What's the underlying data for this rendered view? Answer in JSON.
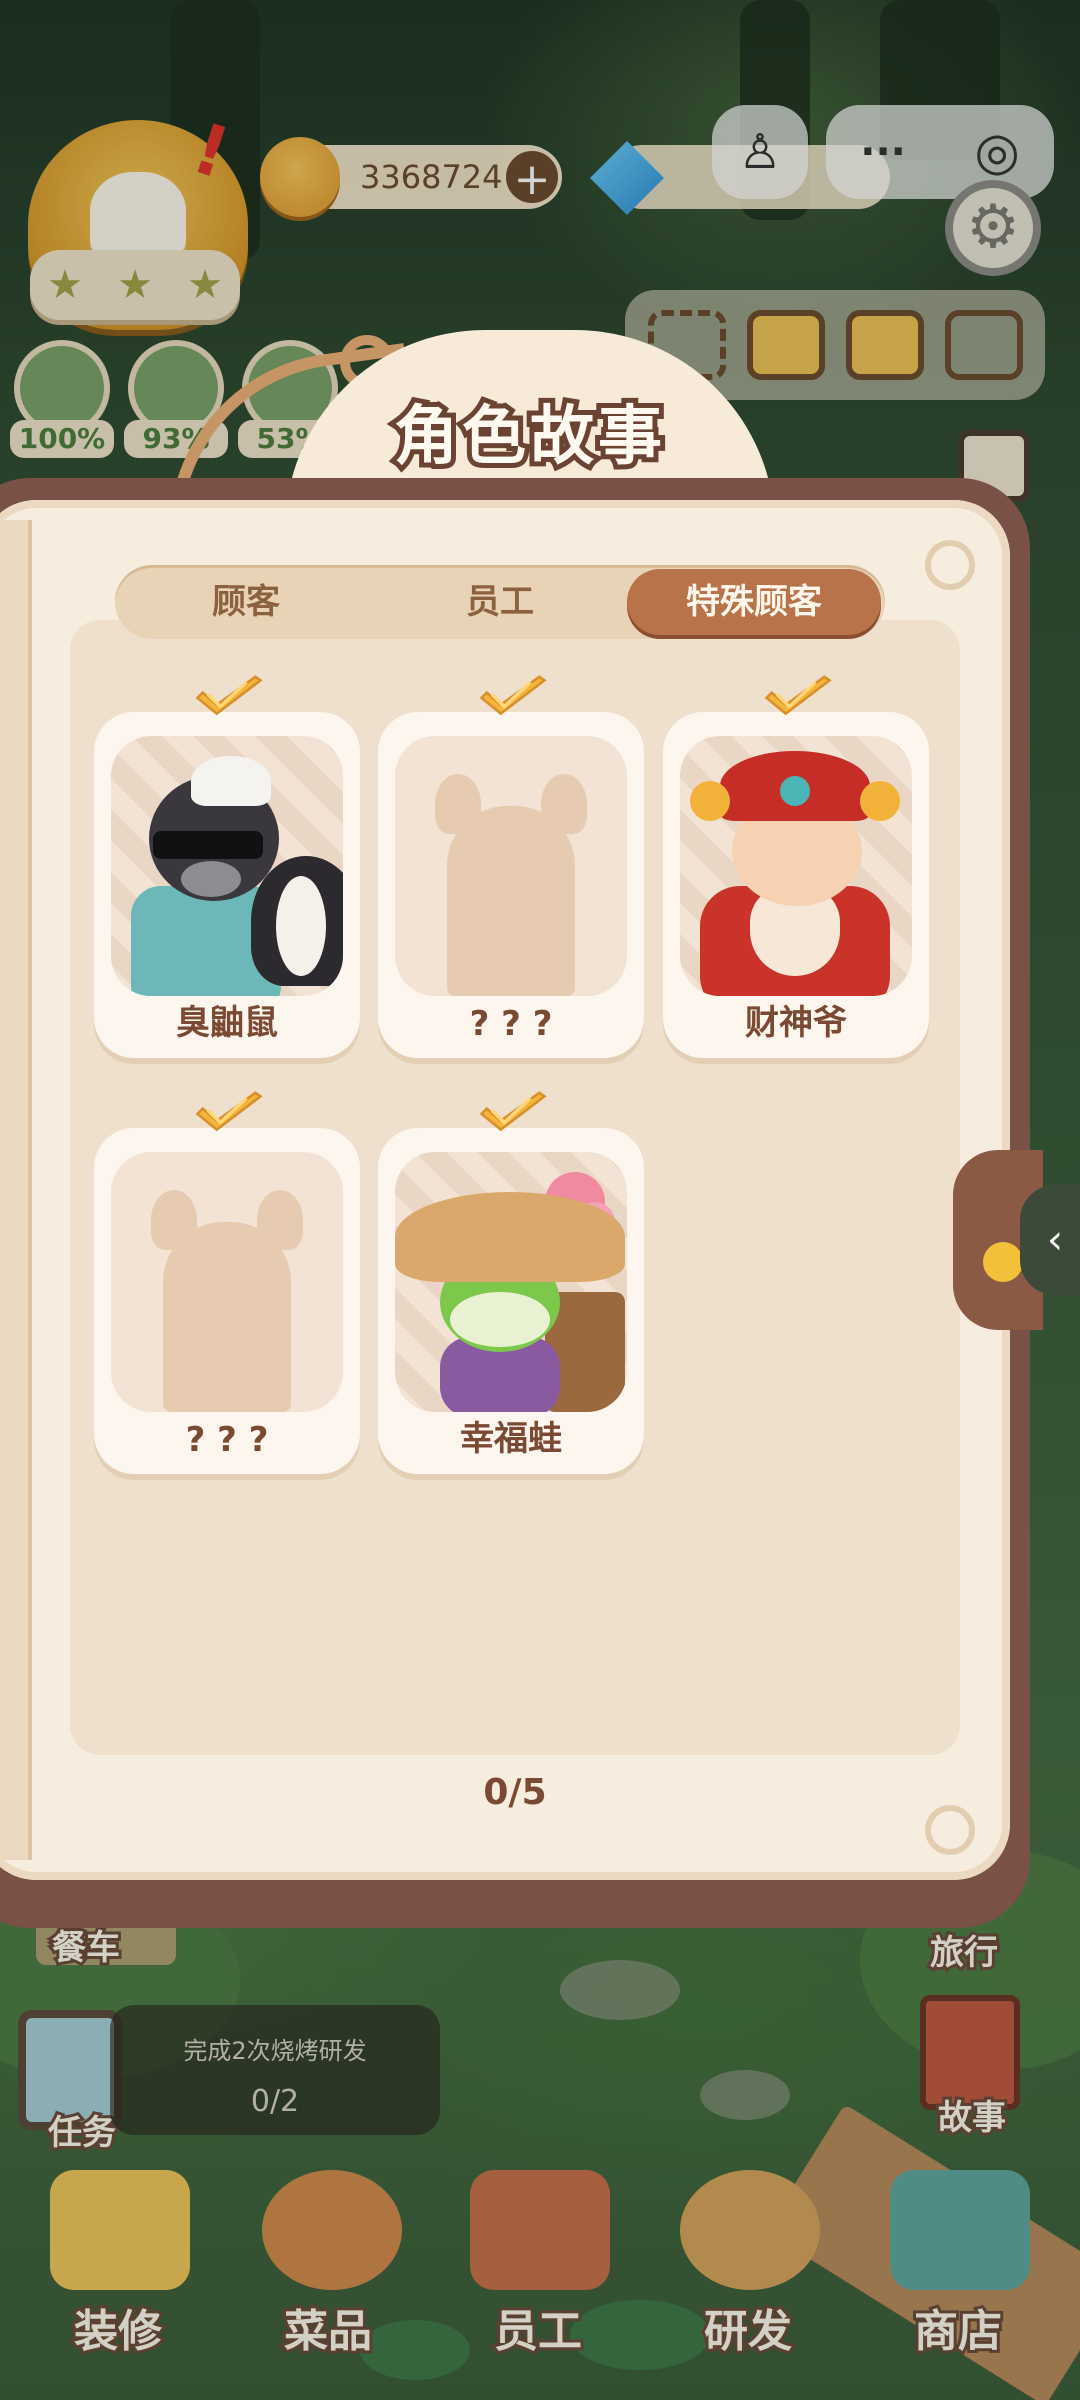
{
  "hud": {
    "coins": "3368724",
    "coin_plus": "+",
    "stats": [
      {
        "pct": "100%"
      },
      {
        "pct": "93%"
      },
      {
        "pct": "53%"
      }
    ],
    "capsule_more": "···",
    "capsule_target": "◎",
    "gear": "⚙"
  },
  "modal": {
    "title": "角色故事",
    "tabs": [
      {
        "label": "顾客",
        "active": false
      },
      {
        "label": "员工",
        "active": false
      },
      {
        "label": "特殊顾客",
        "active": true
      }
    ],
    "cards": [
      {
        "name": "臭鼬鼠",
        "unlocked": true
      },
      {
        "name": "? ? ?",
        "unlocked": false
      },
      {
        "name": "财神爷",
        "unlocked": true
      },
      {
        "name": "? ? ?",
        "unlocked": false
      },
      {
        "name": "幸福蛙",
        "unlocked": true
      }
    ],
    "progress": "0/5",
    "side_arrow": "‹"
  },
  "bottom": {
    "car_label": "餐车",
    "travel_label": "旅行",
    "quest_label": "任务",
    "quest_title": "完成2次烧烤研发",
    "quest_progress": "0/2",
    "story_label": "故事",
    "nav": [
      {
        "label": "装修"
      },
      {
        "label": "菜品"
      },
      {
        "label": "员工"
      },
      {
        "label": "研发"
      },
      {
        "label": "商店"
      }
    ]
  }
}
